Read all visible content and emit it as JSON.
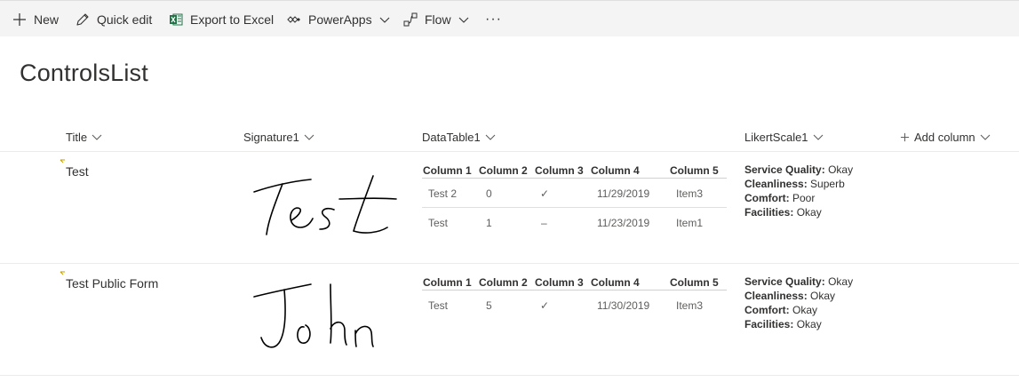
{
  "toolbar": {
    "new_label": "New",
    "quick_edit_label": "Quick edit",
    "export_label": "Export to Excel",
    "powerapps_label": "PowerApps",
    "flow_label": "Flow",
    "more_label": "···"
  },
  "list_title": "ControlsList",
  "columns": {
    "title": "Title",
    "signature": "Signature1",
    "datatable": "DataTable1",
    "likert": "LikertScale1",
    "add_column": "Add column"
  },
  "rows": [
    {
      "title": "Test",
      "signature_text": "Test",
      "datatable": {
        "headers": [
          "Column 1",
          "Column 2",
          "Column 3",
          "Column 4",
          "Column 5"
        ],
        "rows": [
          [
            "Test 2",
            "0",
            "✓",
            "11/29/2019",
            "Item3"
          ],
          [
            "Test",
            "1",
            "–",
            "11/23/2019",
            "Item1"
          ]
        ]
      },
      "likert": [
        {
          "label": "Service Quality:",
          "value": "Okay"
        },
        {
          "label": "Cleanliness:",
          "value": "Superb"
        },
        {
          "label": "Comfort:",
          "value": "Poor"
        },
        {
          "label": "Facilities:",
          "value": "Okay"
        }
      ]
    },
    {
      "title": "Test Public Form",
      "signature_text": "John",
      "datatable": {
        "headers": [
          "Column 1",
          "Column 2",
          "Column 3",
          "Column 4",
          "Column 5"
        ],
        "rows": [
          [
            "Test",
            "5",
            "✓",
            "11/30/2019",
            "Item3"
          ]
        ]
      },
      "likert": [
        {
          "label": "Service Quality:",
          "value": "Okay"
        },
        {
          "label": "Cleanliness:",
          "value": "Okay"
        },
        {
          "label": "Comfort:",
          "value": "Okay"
        },
        {
          "label": "Facilities:",
          "value": "Okay"
        }
      ]
    }
  ],
  "colors": {
    "toolbar_bg": "#f4f4f4",
    "text": "#323130",
    "excel_green": "#217346",
    "new_badge": "#c19c00"
  }
}
